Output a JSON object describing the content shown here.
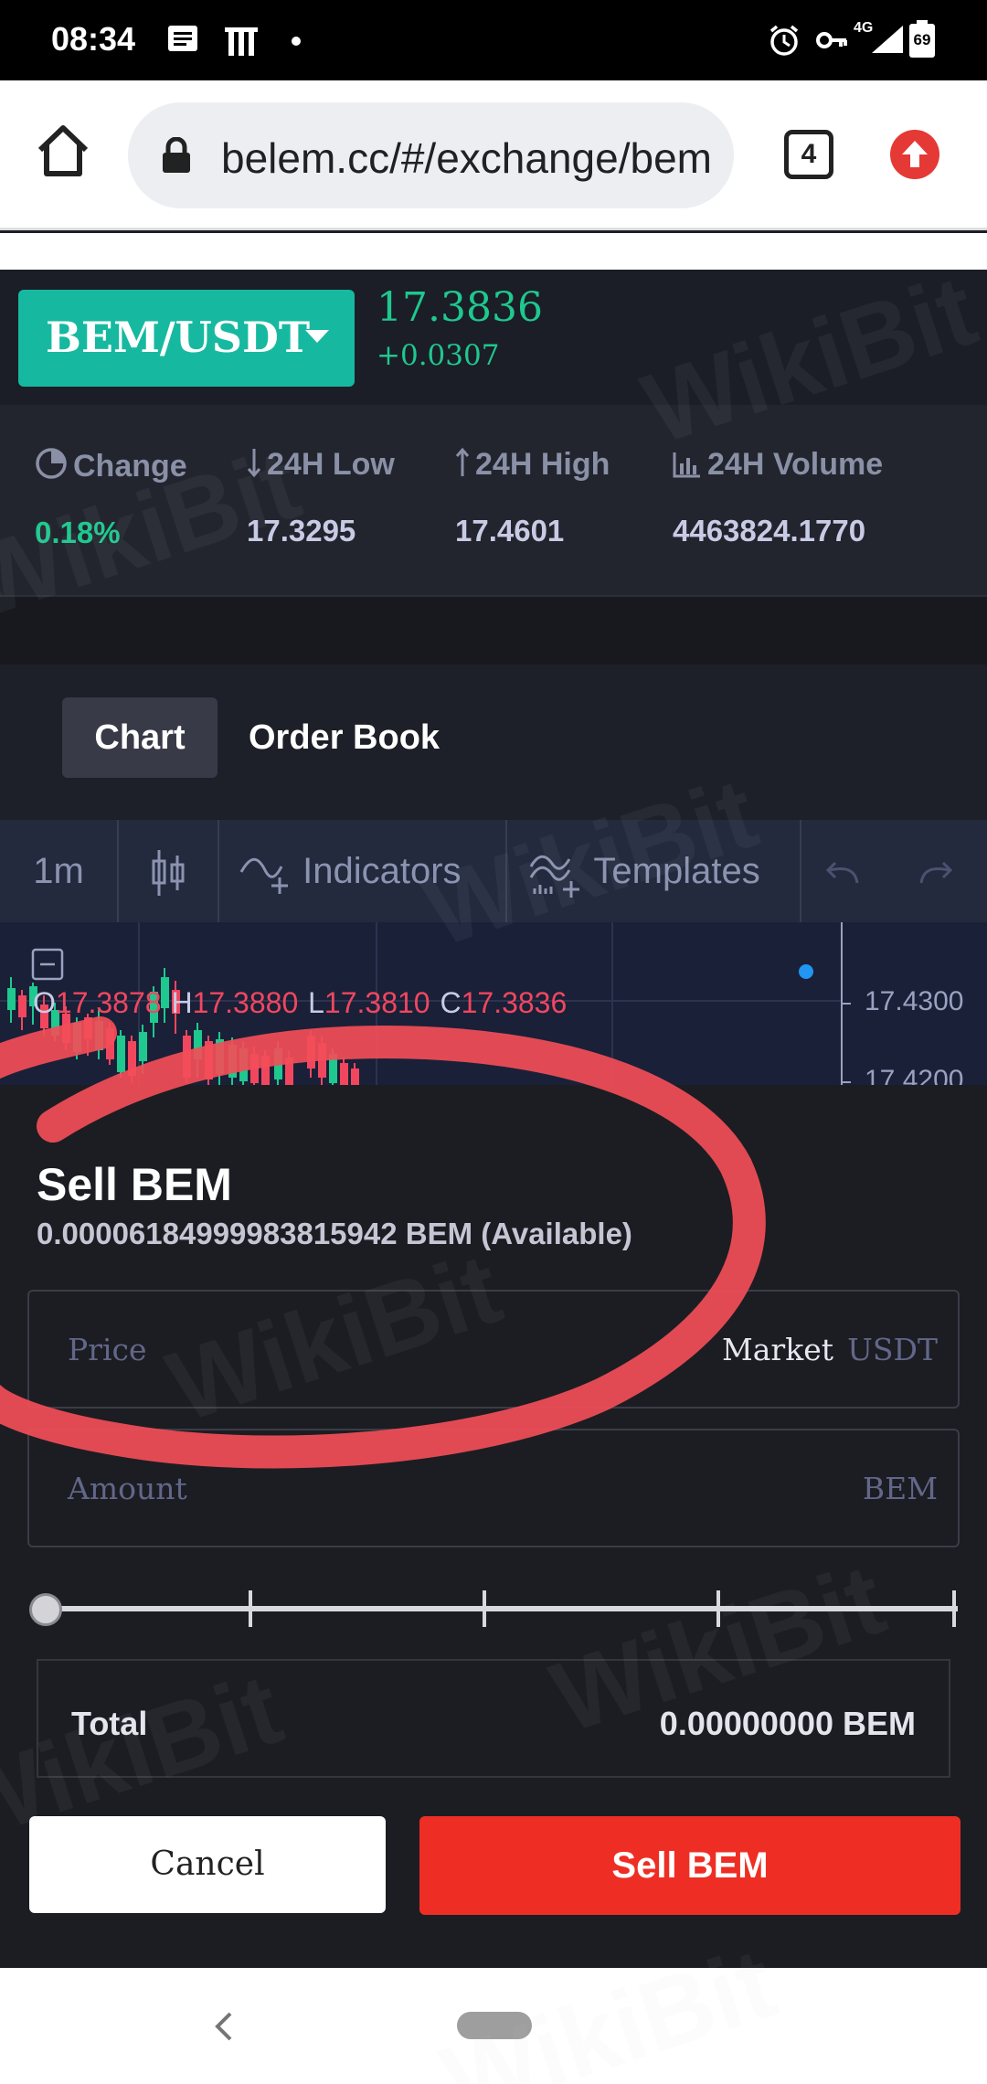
{
  "status_bar": {
    "time": "08:34",
    "network": "4G",
    "battery": "69"
  },
  "browser": {
    "url": "belem.cc/#/exchange/bem",
    "tab_count": "4",
    "icons": [
      "home-icon",
      "lock-icon",
      "tab-switcher-icon",
      "update-icon"
    ]
  },
  "ticker": {
    "pair": "BEM/USDT",
    "last_price": "17.3836",
    "change_abs": "+0.0307",
    "up_color": "#1fc88e",
    "accent_color": "#16b9a0"
  },
  "stats": {
    "change": {
      "label": "Change",
      "value": "0.18%"
    },
    "low": {
      "label": "24H Low",
      "value": "17.3295"
    },
    "high": {
      "label": "24H High",
      "value": "17.4601"
    },
    "volume": {
      "label": "24H Volume",
      "value": "4463824.1770"
    }
  },
  "tabs": {
    "chart": "Chart",
    "order_book": "Order Book"
  },
  "chart_toolbar": {
    "interval": "1m",
    "indicators": "Indicators",
    "templates": "Templates"
  },
  "chart": {
    "ohlc": {
      "o_label": "O",
      "o": "17.3878",
      "h_label": "H",
      "h": "17.3880",
      "l_label": "L",
      "l": "17.3810",
      "c_label": "C",
      "c": "17.3836"
    },
    "price_ticks": [
      "17.4300",
      "17.4200"
    ],
    "down_color": "#f0475f"
  },
  "sell_form": {
    "title": "Sell BEM",
    "available": "0.00006184999983815942 BEM (Available)",
    "price_placeholder": "Price",
    "price_mode": "Market",
    "price_unit": "USDT",
    "amount_placeholder": "Amount",
    "amount_unit": "BEM",
    "slider_fraction": 0,
    "total_label": "Total",
    "total_value": "0.00000000 BEM",
    "cancel": "Cancel",
    "sell_button": "Sell BEM",
    "sell_color": "#ee2e24"
  },
  "watermark": "WikiBit"
}
